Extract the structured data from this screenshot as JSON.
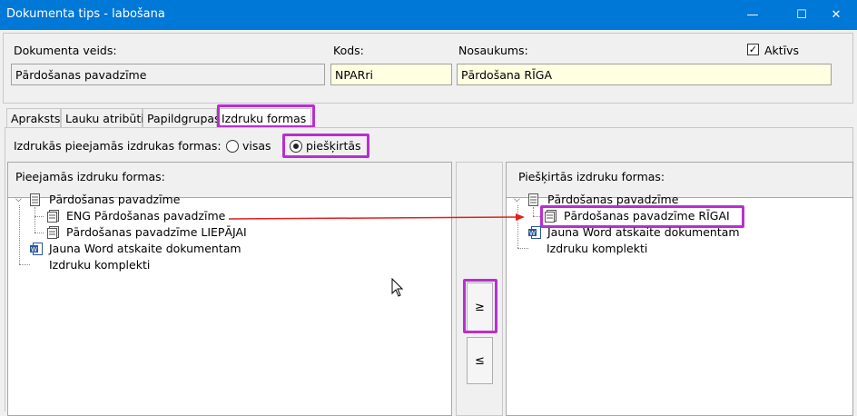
{
  "window": {
    "title": "Dokumenta tips - labošana",
    "minimize": "—",
    "maximize": "☐",
    "close": "✕"
  },
  "header": {
    "doc_type_label": "Dokumenta veids:",
    "doc_type_value": "Pārdošanas pavadzīme",
    "code_label": "Kods:",
    "code_value": "NPARri",
    "name_label": "Nosaukums:",
    "name_value": "Pārdošana RĪGA",
    "active_label": "Aktīvs",
    "active_checked": true
  },
  "tabs": [
    {
      "label": "Apraksts"
    },
    {
      "label": "Lauku atribūti"
    },
    {
      "label": "Papildgrupas"
    },
    {
      "label": "Izdruku formas",
      "active": true
    }
  ],
  "filter": {
    "label": "Izdrukās pieejamās izdrukas formas:",
    "option_all": "visas",
    "option_assigned": "piešķirtās",
    "selected": "piešķirtās"
  },
  "left_panel": {
    "title": "Pieejamās izdruku formas:",
    "items": [
      "Pārdošanas pavadzīme",
      "ENG Pārdošanas pavadzīme",
      "Pārdošanas pavadzīme LIEPĀJAI",
      "Jauna Word atskaite dokumentam",
      "Izdruku komplekti"
    ]
  },
  "buttons": {
    "add": "≥",
    "remove": "≤"
  },
  "right_panel": {
    "title": "Piešķirtās izdruku formas:",
    "items": [
      "Pārdošanas pavadzīme",
      "Pārdošanas pavadzīme RĪGAI",
      "Jauna Word atskaite dokumentam",
      "Izdruku komplekti"
    ]
  },
  "colors": {
    "titlebar": "#0078d7",
    "highlight": "#b92ed1",
    "arrow": "#e02020",
    "field_yellow": "#ffffe1"
  }
}
